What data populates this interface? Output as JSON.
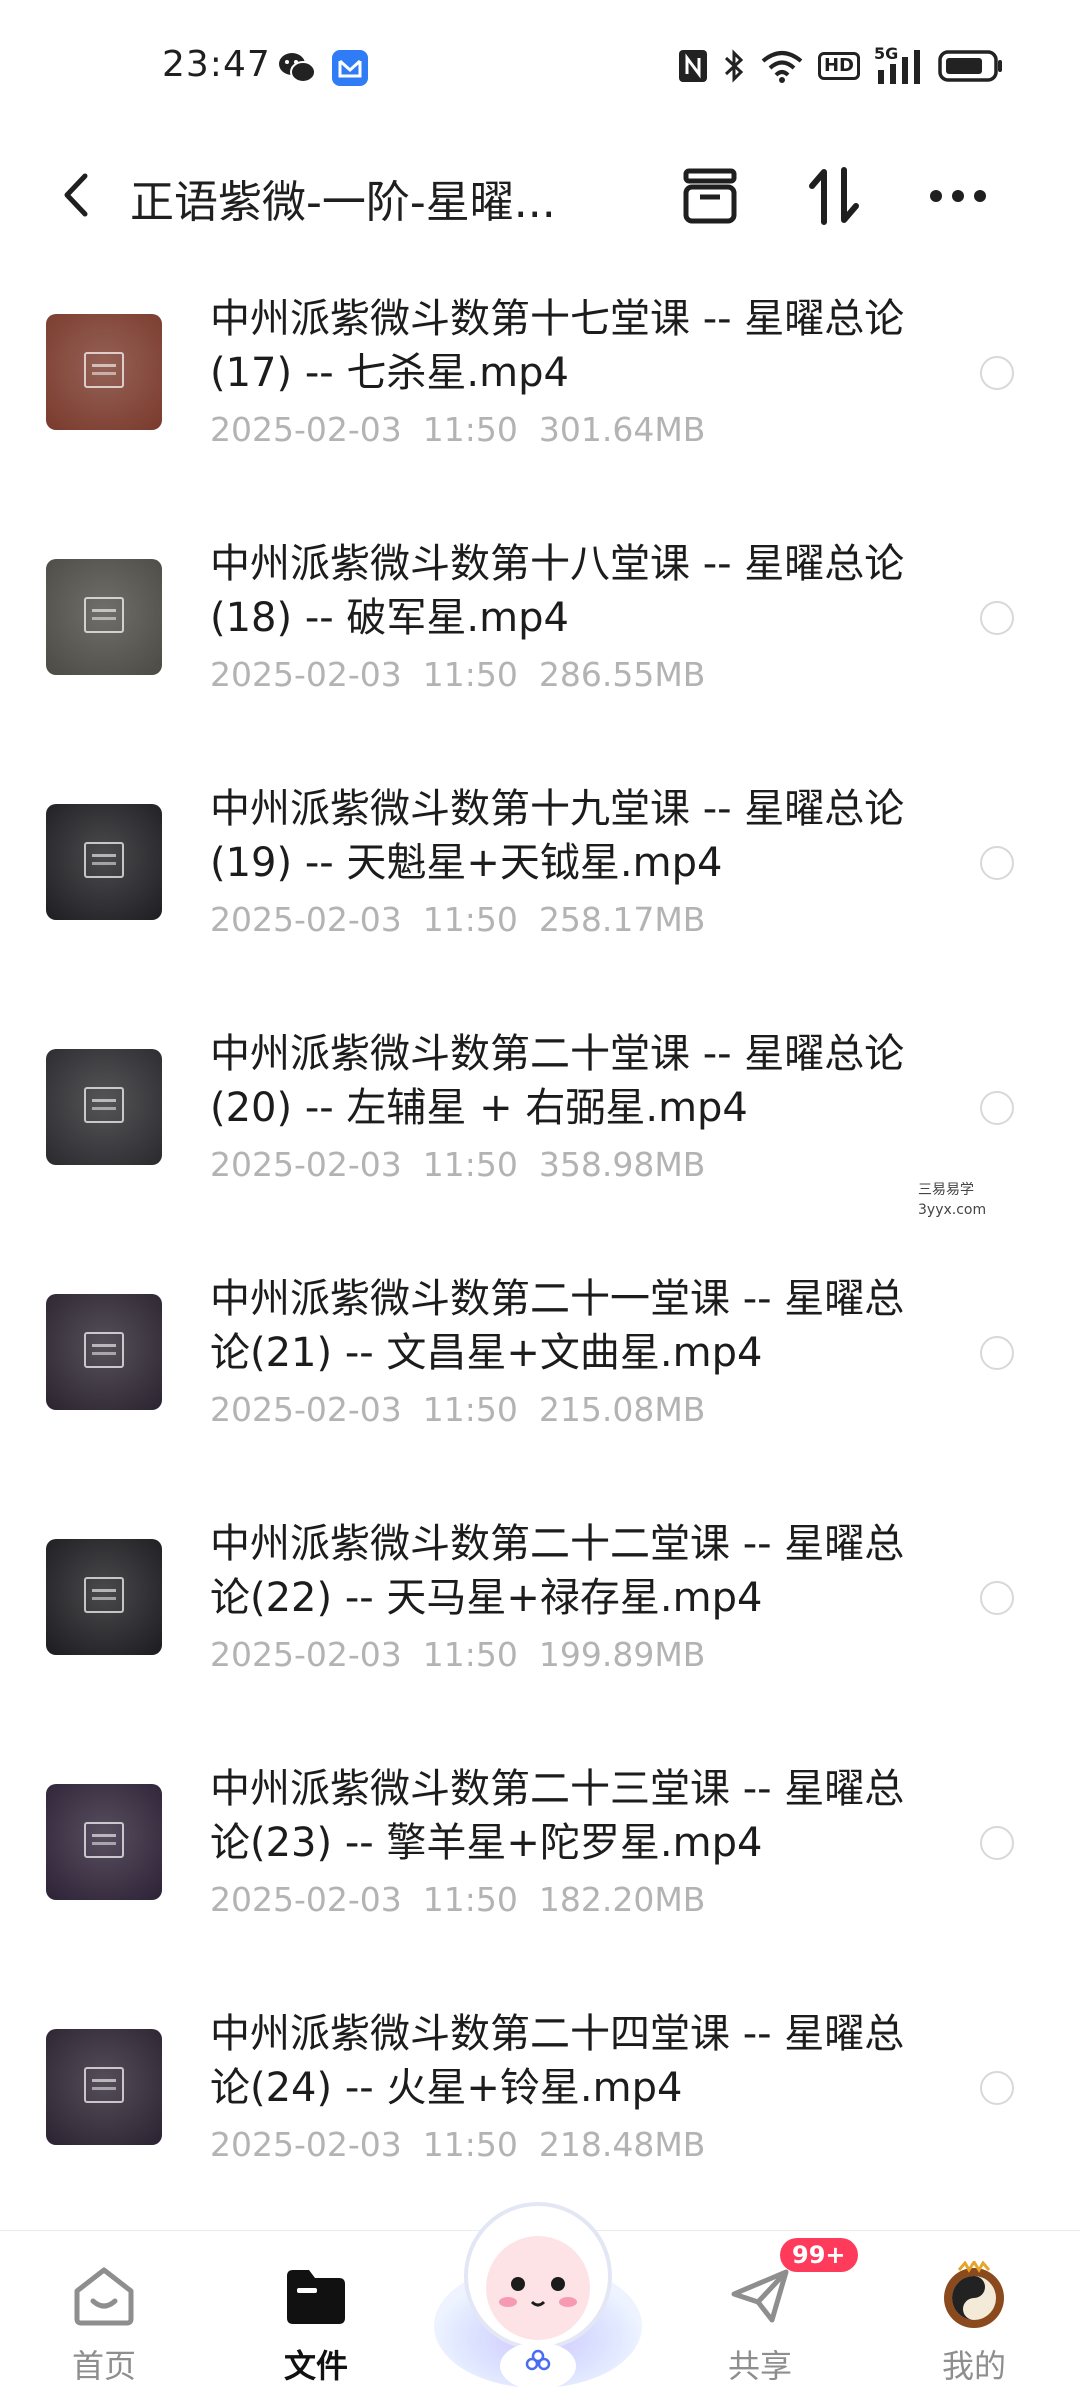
{
  "status_bar": {
    "time": "23:47",
    "left_icons": [
      "wechat-icon",
      "mail-app-icon"
    ],
    "right_icons": [
      "nfc-icon",
      "bluetooth-icon",
      "wifi-icon",
      "hd-icon",
      "5g-signal-icon",
      "battery-icon"
    ],
    "hd_label": "HD",
    "net_label": "5G"
  },
  "app_bar": {
    "title": "正语紫微-一阶-星曜...",
    "actions": [
      "archive-icon",
      "sort-icon",
      "more-icon"
    ]
  },
  "files": [
    {
      "name": "中州派紫微斗数第十七堂课 -- 星曜总论(17) -- 七杀星.mp4",
      "date": "2025-02-03",
      "time": "11:50",
      "size": "301.64MB",
      "thumb": "#7a3a2c"
    },
    {
      "name": "中州派紫微斗数第十八堂课 -- 星曜总论(18) --  破军星.mp4",
      "date": "2025-02-03",
      "time": "11:50",
      "size": "286.55MB",
      "thumb": "#4c4a44"
    },
    {
      "name": "中州派紫微斗数第十九堂课 -- 星曜总论(19) --  天魁星+天钺星.mp4",
      "date": "2025-02-03",
      "time": "11:50",
      "size": "258.17MB",
      "thumb": "#1e1e22"
    },
    {
      "name": "中州派紫微斗数第二十堂课 -- 星曜总论(20) -- 左辅星 + 右弼星.mp4",
      "date": "2025-02-03",
      "time": "11:50",
      "size": "358.98MB",
      "thumb": "#2a2a2e"
    },
    {
      "name": "中州派紫微斗数第二十一堂课 -- 星曜总论(21) -- 文昌星+文曲星.mp4",
      "date": "2025-02-03",
      "time": "11:50",
      "size": "215.08MB",
      "thumb": "#2b2430"
    },
    {
      "name": "中州派紫微斗数第二十二堂课 -- 星曜总论(22) -- 天马星+禄存星.mp4",
      "date": "2025-02-03",
      "time": "11:50",
      "size": "199.89MB",
      "thumb": "#1c1c20"
    },
    {
      "name": "中州派紫微斗数第二十三堂课 -- 星曜总论(23) -- 擎羊星+陀罗星.mp4",
      "date": "2025-02-03",
      "time": "11:50",
      "size": "182.20MB",
      "thumb": "#2d2236"
    },
    {
      "name": "中州派紫微斗数第二十四堂课 -- 星曜总论(24) -- 火星+铃星.mp4",
      "date": "2025-02-03",
      "time": "11:50",
      "size": "218.48MB",
      "thumb": "#2a2230"
    }
  ],
  "watermark": {
    "line1": "三易易学",
    "line2": "3yyx.com"
  },
  "bottom_nav": {
    "items": [
      {
        "label": "首页",
        "icon": "home-icon"
      },
      {
        "label": "文件",
        "icon": "folder-icon"
      },
      {
        "label": "共享",
        "icon": "share-plane-icon"
      },
      {
        "label": "我的",
        "icon": "avatar-icon"
      }
    ],
    "badge": "99+",
    "active_index": 1
  }
}
